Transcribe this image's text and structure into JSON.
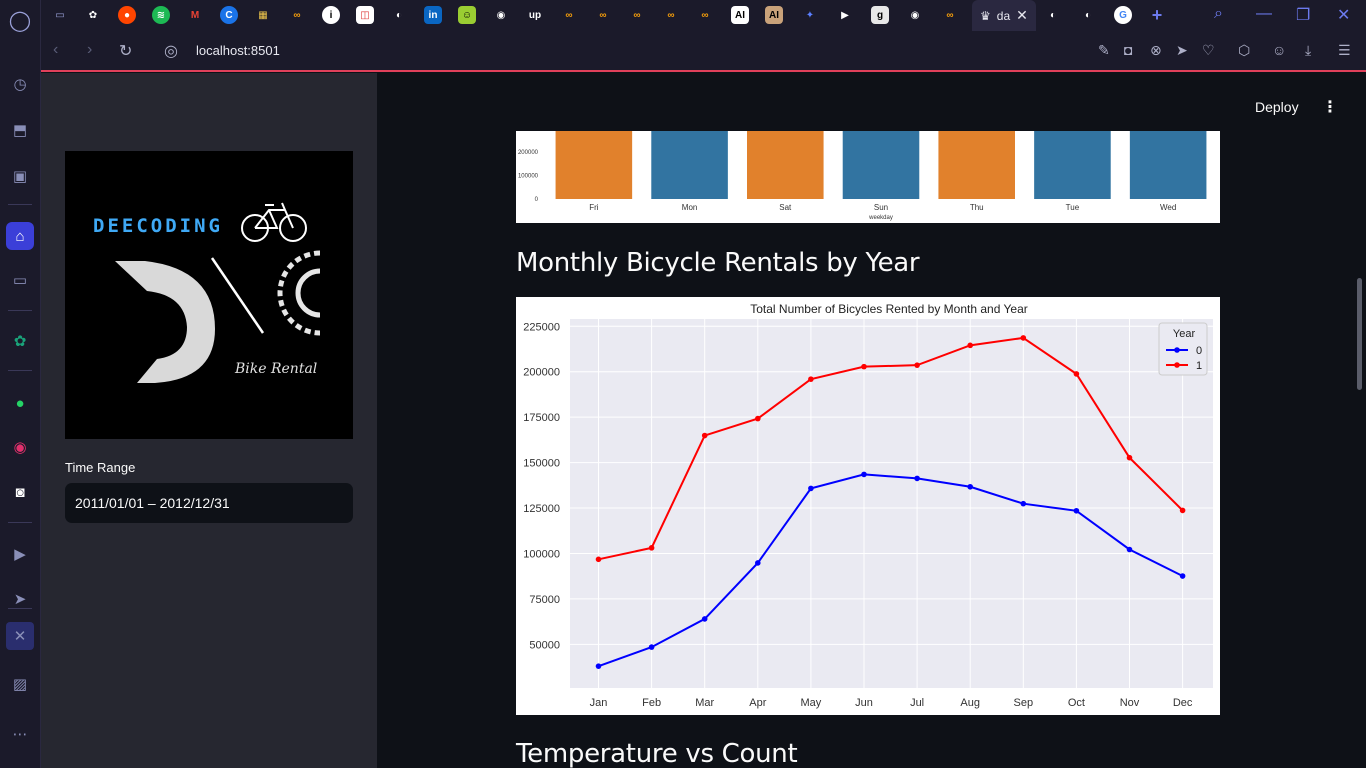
{
  "browser": {
    "active_tab_title": "da",
    "url": "localhost:8501",
    "tab_icons": [
      "gamepad-icon",
      "openai-icon",
      "reddit-icon",
      "spotify-icon",
      "gmail-icon",
      "c-icon",
      "folder-icon",
      "infinity-icon",
      "info-icon",
      "pdf-icon",
      "globe-icon",
      "linkedin-icon",
      "emoji-icon",
      "github-icon",
      "up-icon",
      "infinity-icon",
      "infinity-icon",
      "infinity-icon",
      "infinity-icon",
      "ai-icon",
      "ai-icon",
      "pin-icon",
      "terminal-icon",
      "g-icon",
      "github-icon",
      "infinity-icon"
    ],
    "up_label": "up",
    "ai_label": "AI",
    "g_label": "g"
  },
  "sidebar": {
    "logo_text": "DEECODING",
    "logo_subtext": "Bike Rental",
    "time_range_label": "Time Range",
    "time_range_value": "2011/01/01 – 2012/12/31"
  },
  "header": {
    "deploy_label": "Deploy"
  },
  "main": {
    "section_monthly_title": "Monthly Bicycle Rentals by Year",
    "section_temp_title": "Temperature vs Count"
  },
  "chart_data": [
    {
      "type": "bar",
      "categories": [
        "Fri",
        "Mon",
        "Sat",
        "Sun",
        "Thu",
        "Tue",
        "Wed"
      ],
      "xlabel": "weekday",
      "ytick_labels": [
        "0",
        "100000",
        "200000"
      ],
      "colors": [
        "#e1812c",
        "#3274a1",
        "#e1812c",
        "#3274a1",
        "#e1812c",
        "#3274a1",
        "#3274a1"
      ]
    },
    {
      "type": "line",
      "title": "Total Number of Bicycles Rented by Month and Year",
      "legend_title": "Year",
      "legend_position": "top-right",
      "categories": [
        "Jan",
        "Feb",
        "Mar",
        "Apr",
        "May",
        "Jun",
        "Jul",
        "Aug",
        "Sep",
        "Oct",
        "Nov",
        "Dec"
      ],
      "yticks": [
        50000,
        75000,
        100000,
        125000,
        150000,
        175000,
        200000,
        225000
      ],
      "ylim": [
        26000,
        229000
      ],
      "series": [
        {
          "name": "0",
          "color": "#0000ff",
          "values": [
            38000,
            48500,
            64000,
            94800,
            135800,
            143500,
            141300,
            136700,
            127400,
            123500,
            102200,
            87600
          ]
        },
        {
          "name": "1",
          "color": "#ff0000",
          "values": [
            96800,
            103100,
            164900,
            174200,
            195900,
            202800,
            203600,
            214500,
            218600,
            198800,
            152700,
            123700
          ]
        }
      ]
    }
  ]
}
